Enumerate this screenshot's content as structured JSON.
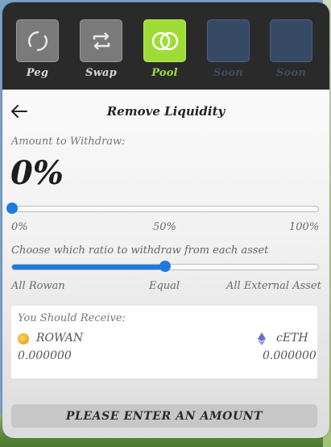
{
  "nav": {
    "items": [
      {
        "label": "Peg"
      },
      {
        "label": "Swap"
      },
      {
        "label": "Pool"
      },
      {
        "label": "Soon"
      },
      {
        "label": "Soon"
      }
    ]
  },
  "page": {
    "title": "Remove Liquidity"
  },
  "withdraw": {
    "label": "Amount to Withdraw:",
    "value": "0%",
    "slider_value_percent": 0,
    "ticks": [
      "0%",
      "50%",
      "100%"
    ]
  },
  "ratio": {
    "label": "Choose which ratio to withdraw from each asset",
    "slider_value_fraction": 0.5,
    "ticks": [
      "All Rowan",
      "Equal",
      "All External Asset"
    ]
  },
  "receive": {
    "title": "You Should Receive:",
    "asset_a": {
      "symbol": "ROWAN",
      "amount": "0.000000"
    },
    "asset_b": {
      "symbol": "cETH",
      "amount": "0.000000"
    }
  },
  "cta": {
    "label": "PLEASE ENTER AN AMOUNT"
  },
  "colors": {
    "accent_green": "#9fdc35",
    "slider_blue": "#1f7ae0",
    "nav_bg": "#2a2a2a"
  }
}
